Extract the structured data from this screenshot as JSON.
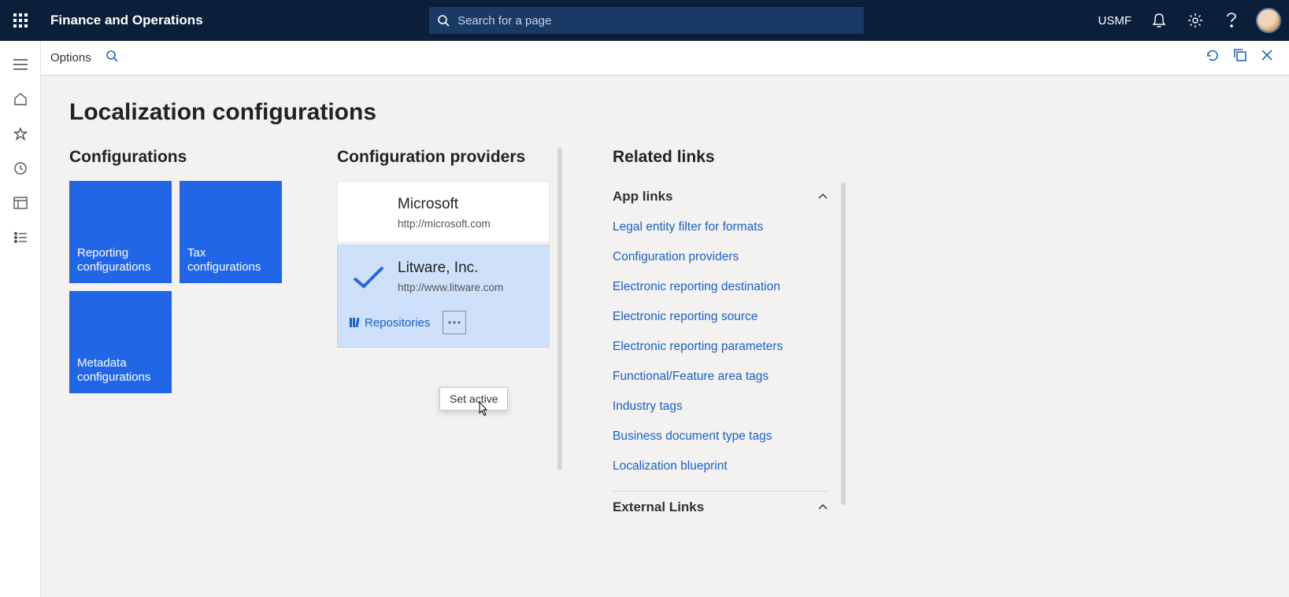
{
  "header": {
    "app_title": "Finance and Operations",
    "search_placeholder": "Search for a page",
    "company": "USMF"
  },
  "cmdbar": {
    "options": "Options"
  },
  "page": {
    "title": "Localization configurations"
  },
  "configurations": {
    "heading": "Configurations",
    "tiles": [
      {
        "label": "Reporting configurations"
      },
      {
        "label": "Tax configurations"
      },
      {
        "label": "Metadata configurations"
      }
    ]
  },
  "providers": {
    "heading": "Configuration providers",
    "items": [
      {
        "name": "Microsoft",
        "url": "http://microsoft.com",
        "active": false
      },
      {
        "name": "Litware, Inc.",
        "url": "http://www.litware.com",
        "active": true
      }
    ],
    "repositories_label": "Repositories",
    "flyout_label": "Set active"
  },
  "related": {
    "heading": "Related links",
    "group_app": "App links",
    "group_ext": "External Links",
    "app_links": [
      "Legal entity filter for formats",
      "Configuration providers",
      "Electronic reporting destination",
      "Electronic reporting source",
      "Electronic reporting parameters",
      "Functional/Feature area tags",
      "Industry tags",
      "Business document type tags",
      "Localization blueprint"
    ]
  }
}
